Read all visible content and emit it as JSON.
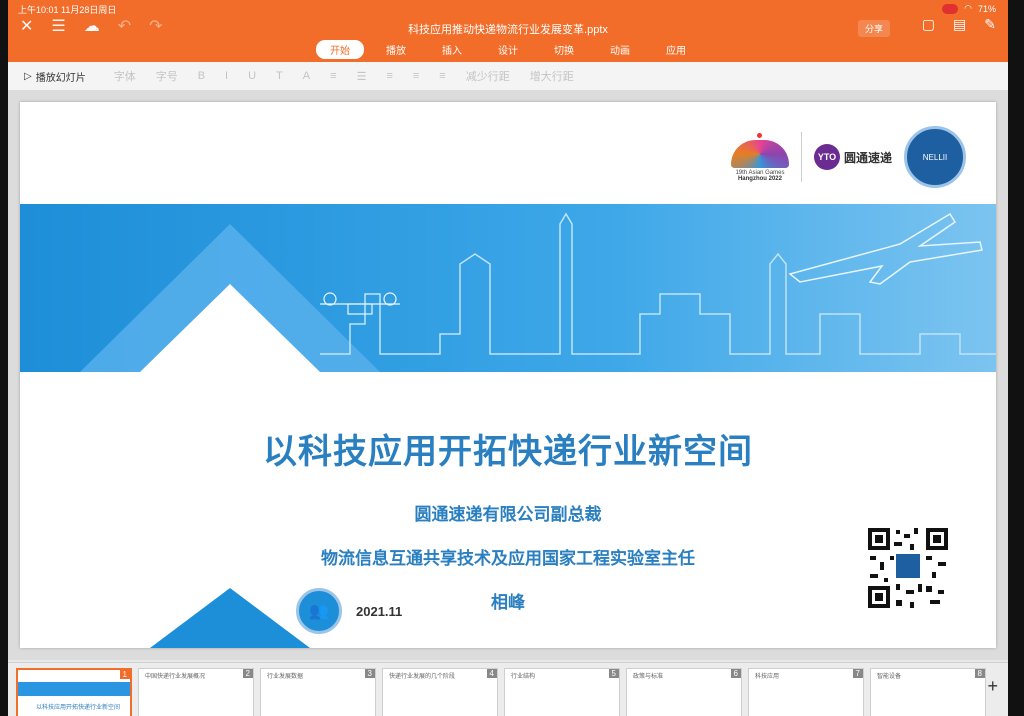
{
  "status_bar": {
    "time_date": "上午10:01  11月28日周日",
    "battery": "71%"
  },
  "topbar": {
    "file_title": "科技应用推动快递物流行业发展变革.pptx",
    "share_label": "分享",
    "tabs": [
      "开始",
      "播放",
      "插入",
      "设计",
      "切换",
      "动画",
      "应用"
    ],
    "active_tab": "开始"
  },
  "toolbar": {
    "play_label": "播放幻灯片",
    "font_placeholder": "字体",
    "size_placeholder": "字号",
    "spacing_label": "减少行距",
    "increase_label": "增大行距"
  },
  "slide": {
    "heading": "以科技应用开拓快递行业新空间",
    "subtitle_1": "圆通速递有限公司副总裁",
    "subtitle_2": "物流信息互通共享技术及应用国家工程实验室主任",
    "presenter": "相峰",
    "date": "2021.11",
    "logo_asian_line1": "19th Asian Games",
    "logo_asian_line2": "Hangzhou 2022",
    "logo_yto_badge": "YTO",
    "logo_yto_name": "圆通速递",
    "logo_lab_text": "NELLII"
  },
  "thumbnails": [
    {
      "num": "1",
      "text": "以科技应用开拓快递行业新空间"
    },
    {
      "num": "2",
      "text": "中国快递行业发展概况"
    },
    {
      "num": "3",
      "text": "行业发展数据"
    },
    {
      "num": "4",
      "text": "快递行业发展的几个阶段"
    },
    {
      "num": "5",
      "text": "行业结构"
    },
    {
      "num": "6",
      "text": "政策与标准"
    },
    {
      "num": "7",
      "text": "科技应用"
    },
    {
      "num": "8",
      "text": "智能设备"
    }
  ],
  "colors": {
    "accent": "#f26d2a",
    "slide_blue": "#2a7fc0",
    "band_blue": "#1d8ed8"
  }
}
